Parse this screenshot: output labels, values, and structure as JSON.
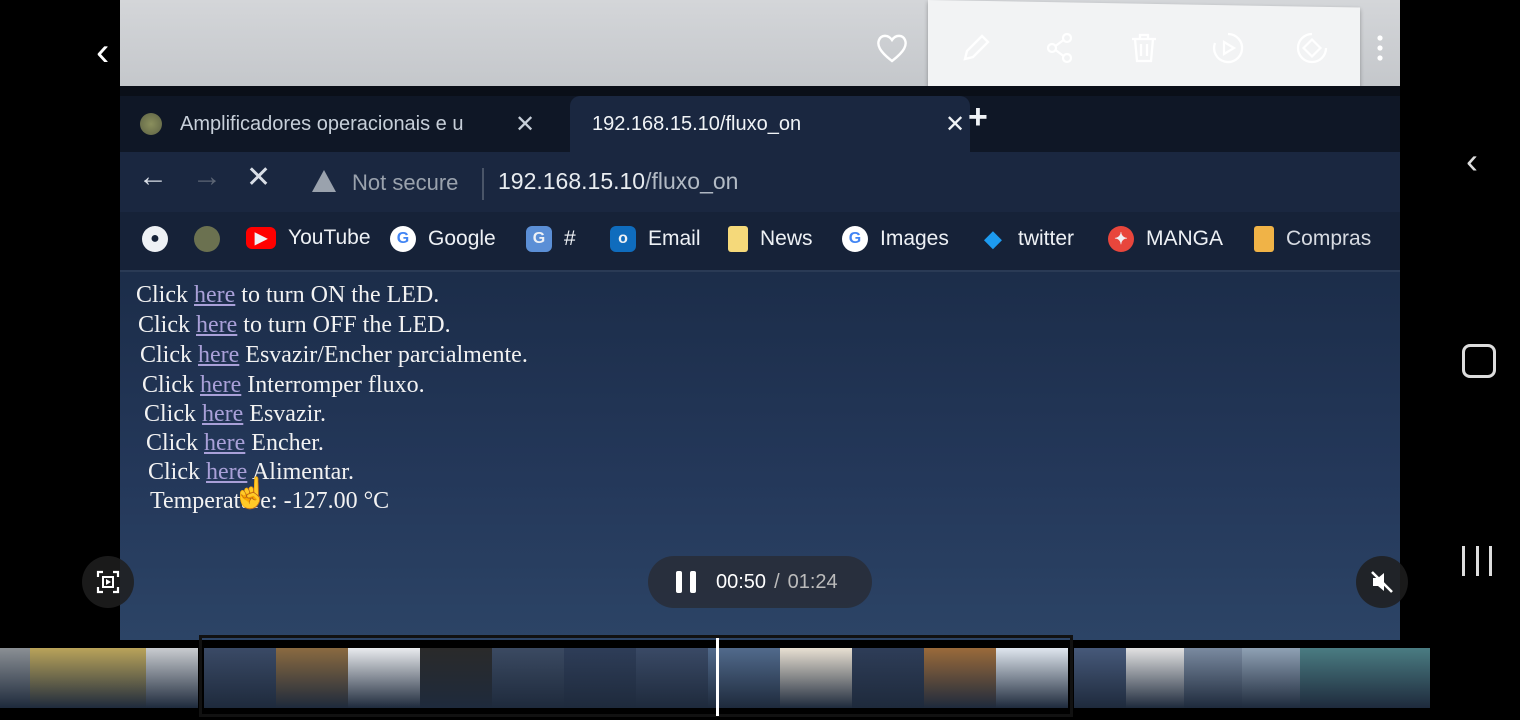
{
  "browser": {
    "tabs": [
      {
        "title": "Amplificadores operacionais e u",
        "close": "✕"
      },
      {
        "title": "192.168.15.10/fluxo_on",
        "close": "✕"
      }
    ],
    "new_tab": "+",
    "nav": {
      "back": "←",
      "forward": "→",
      "stop": "✕"
    },
    "security_label": "Not secure",
    "url_host": "192.168.15.10",
    "url_path": "/fluxo_on",
    "bookmarks": [
      {
        "label": "",
        "icon": "github-icon"
      },
      {
        "label": "",
        "icon": "chatgpt-icon"
      },
      {
        "label": "YouTube",
        "icon": "youtube-icon"
      },
      {
        "label": "Google",
        "icon": "google-icon"
      },
      {
        "label": "#",
        "icon": "translate-icon"
      },
      {
        "label": "Email",
        "icon": "outlook-icon"
      },
      {
        "label": "News",
        "icon": "folder-icon"
      },
      {
        "label": "Images",
        "icon": "google-icon"
      },
      {
        "label": "twitter",
        "icon": "twitter-icon"
      },
      {
        "label": "MANGA",
        "icon": "manga-icon"
      },
      {
        "label": "Compras",
        "icon": "folder-icon"
      }
    ]
  },
  "page": {
    "lines": [
      {
        "prefix": "Click ",
        "link": "here",
        "suffix": " to turn ON the LED."
      },
      {
        "prefix": "Click ",
        "link": "here",
        "suffix": " to turn OFF the LED."
      },
      {
        "prefix": "Click ",
        "link": "here",
        "suffix": " Esvazir/Encher parcialmente."
      },
      {
        "prefix": "Click ",
        "link": "here",
        "suffix": " Interromper fluxo."
      },
      {
        "prefix": "Click ",
        "link": "here",
        "suffix": " Esvazir."
      },
      {
        "prefix": "Click ",
        "link": "here",
        "suffix": " Encher."
      },
      {
        "prefix": "Click ",
        "link": "here",
        "suffix": " Alimentar."
      }
    ],
    "temperature": "Temperature: -127.00 °C"
  },
  "player": {
    "current_time": "00:50",
    "separator": "/",
    "duration": "01:24",
    "progress": 0.595,
    "top_actions": [
      "heart-icon",
      "edit-icon",
      "share-icon",
      "trash-icon",
      "motion-photo-icon",
      "rotate-icon",
      "more-icon"
    ]
  },
  "colors": {
    "screen_bg": "#1b2c48",
    "link": "#a9a0d8",
    "twitter": "#1d9bf0",
    "youtube": "#ff0000"
  }
}
